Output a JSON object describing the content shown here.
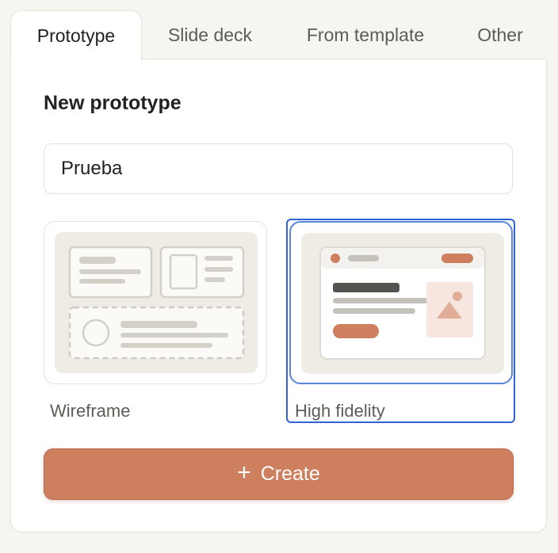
{
  "tabs": [
    {
      "label": "Prototype",
      "active": true
    },
    {
      "label": "Slide deck",
      "active": false
    },
    {
      "label": "From template",
      "active": false
    },
    {
      "label": "Other",
      "active": false
    }
  ],
  "form": {
    "title": "New prototype",
    "name_value": "Prueba"
  },
  "fidelity_options": [
    {
      "label": "Wireframe",
      "selected": false,
      "icon": "wireframe-preview"
    },
    {
      "label": "High fidelity",
      "selected": true,
      "icon": "high-fidelity-preview"
    }
  ],
  "create_button": {
    "label": "Create",
    "icon": "plus-icon"
  },
  "colors": {
    "accent": "#cd7f5e",
    "selection": "#2f63d1",
    "background": "#f6f5f1"
  }
}
